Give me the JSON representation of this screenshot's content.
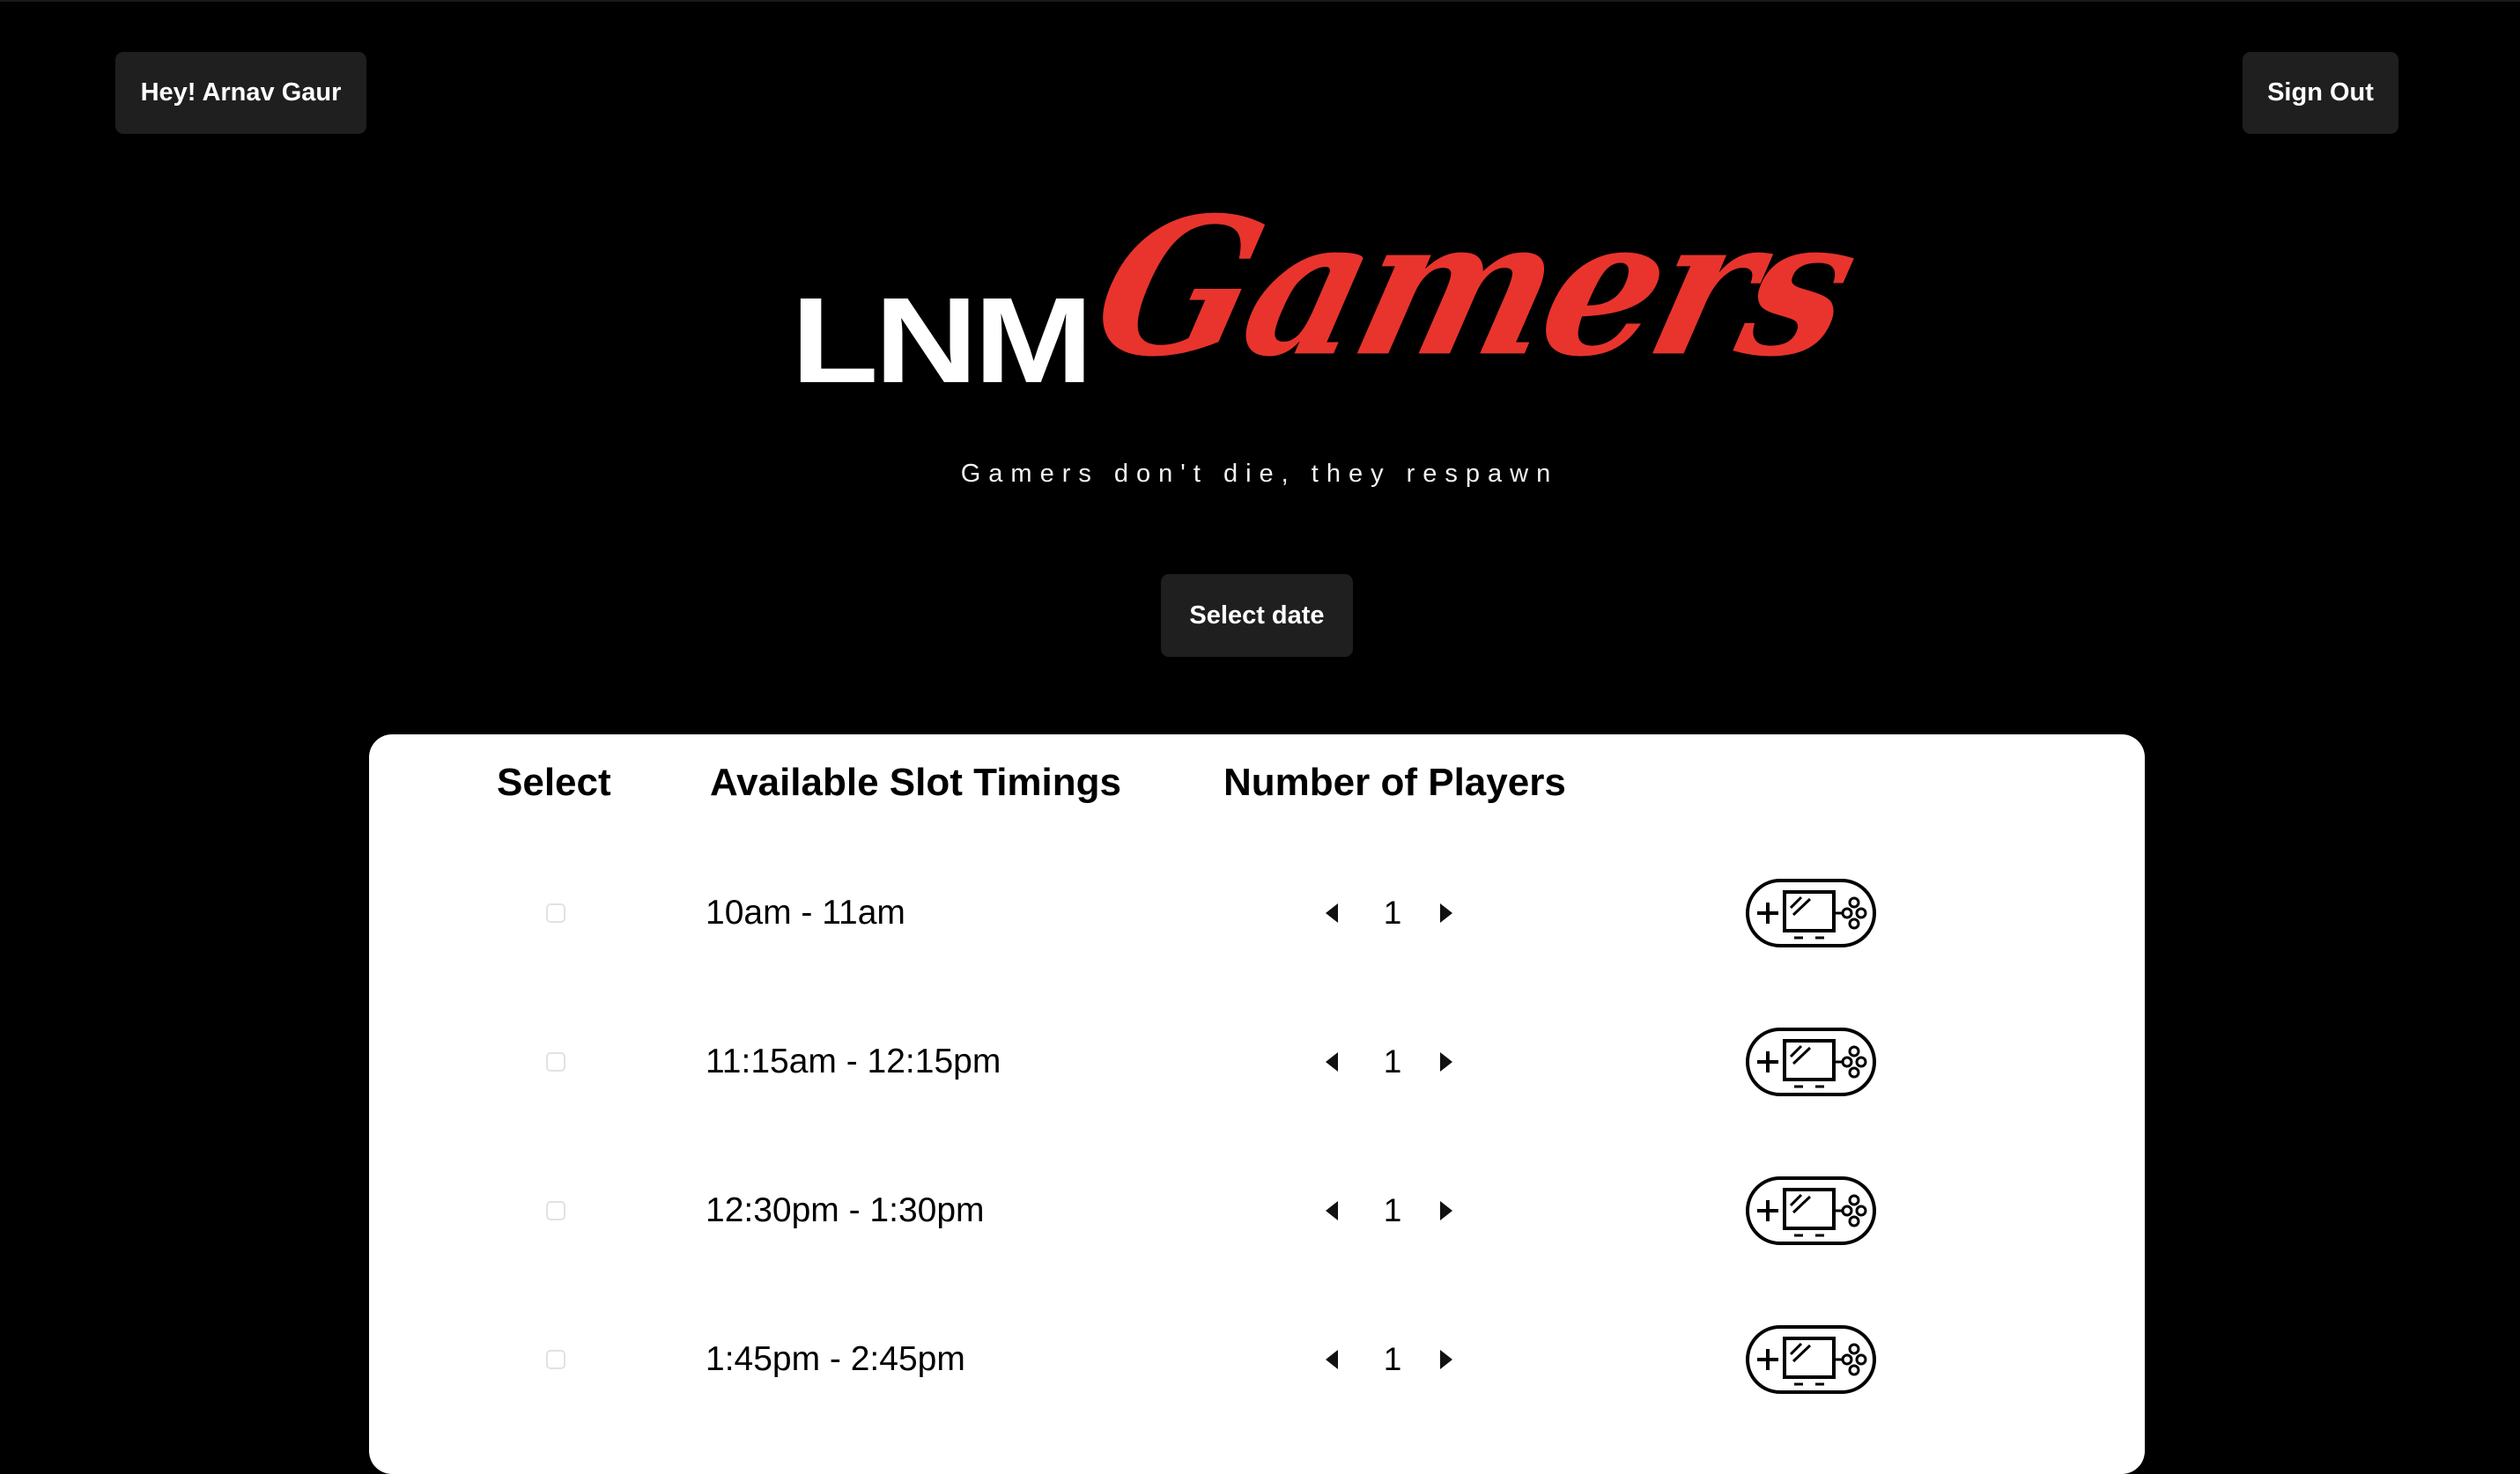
{
  "header": {
    "greeting": "Hey! Arnav Gaur",
    "sign_out": "Sign Out"
  },
  "brand": {
    "logo_text_primary": "LNM",
    "logo_text_script": "Gamers",
    "tagline": "Gamers don't die, they respawn",
    "accent_color": "#e8342d"
  },
  "controls": {
    "select_date": "Select date"
  },
  "table": {
    "headers": {
      "select": "Select",
      "timings": "Available Slot Timings",
      "players": "Number of Players"
    },
    "rows": [
      {
        "time": "10am - 11am",
        "players": "1",
        "selected": false
      },
      {
        "time": "11:15am - 12:15pm",
        "players": "1",
        "selected": false
      },
      {
        "time": "12:30pm - 1:30pm",
        "players": "1",
        "selected": false
      },
      {
        "time": "1:45pm - 2:45pm",
        "players": "1",
        "selected": false
      }
    ]
  },
  "icons": {
    "decrement": "chevron-left-icon",
    "increment": "chevron-right-icon",
    "book": "add-console-icon"
  }
}
